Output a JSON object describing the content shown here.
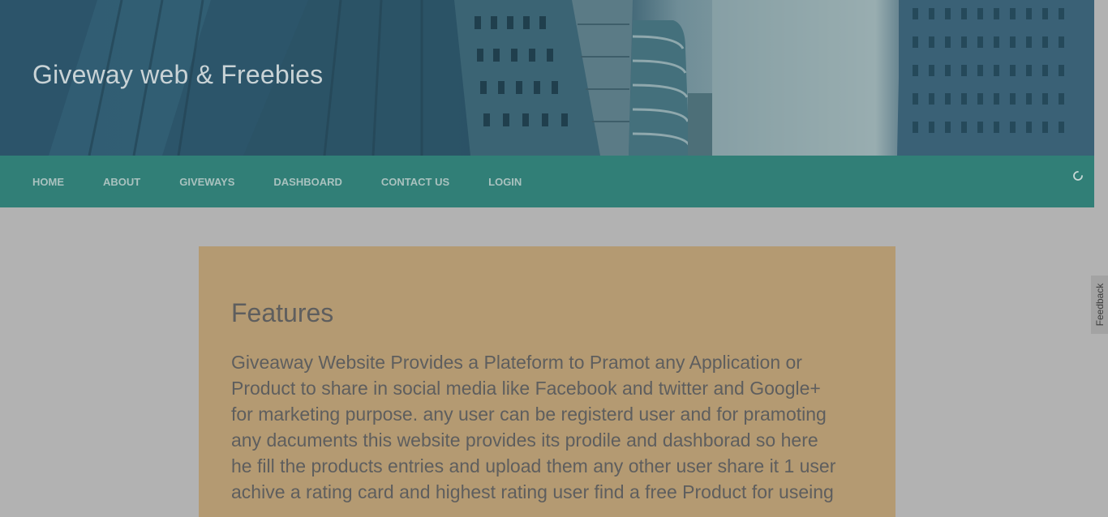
{
  "header": {
    "site_title": "Giveway web & Freebies"
  },
  "nav": {
    "items": [
      {
        "label": "HOME",
        "name": "nav-home"
      },
      {
        "label": "ABOUT",
        "name": "nav-about"
      },
      {
        "label": "GIVEWAYS",
        "name": "nav-giveways"
      },
      {
        "label": "DASHBOARD",
        "name": "nav-dashboard"
      },
      {
        "label": "CONTACT US",
        "name": "nav-contact-us"
      },
      {
        "label": "LOGIN",
        "name": "nav-login"
      }
    ]
  },
  "features": {
    "title": "Features",
    "lines": [
      "Giveaway Website Provides a Plateform to Pramot any Application or",
      "Product to share in social media like Facebook and twitter and Google+",
      "for marketing purpose. any user can be registerd user and for pramoting",
      "any dacuments this website provides its prodile and dashborad so here",
      "he fill the products entries and upload them any other user share it 1 user",
      "achive a rating card and highest rating user find a free Product for useing"
    ]
  },
  "feedback": {
    "label": "Feedback"
  },
  "colors": {
    "navbar": "#317f77",
    "card": "#b49a72",
    "page_background": "#b2b2b2"
  },
  "icons": {
    "spinner": "loading-spinner-icon"
  }
}
